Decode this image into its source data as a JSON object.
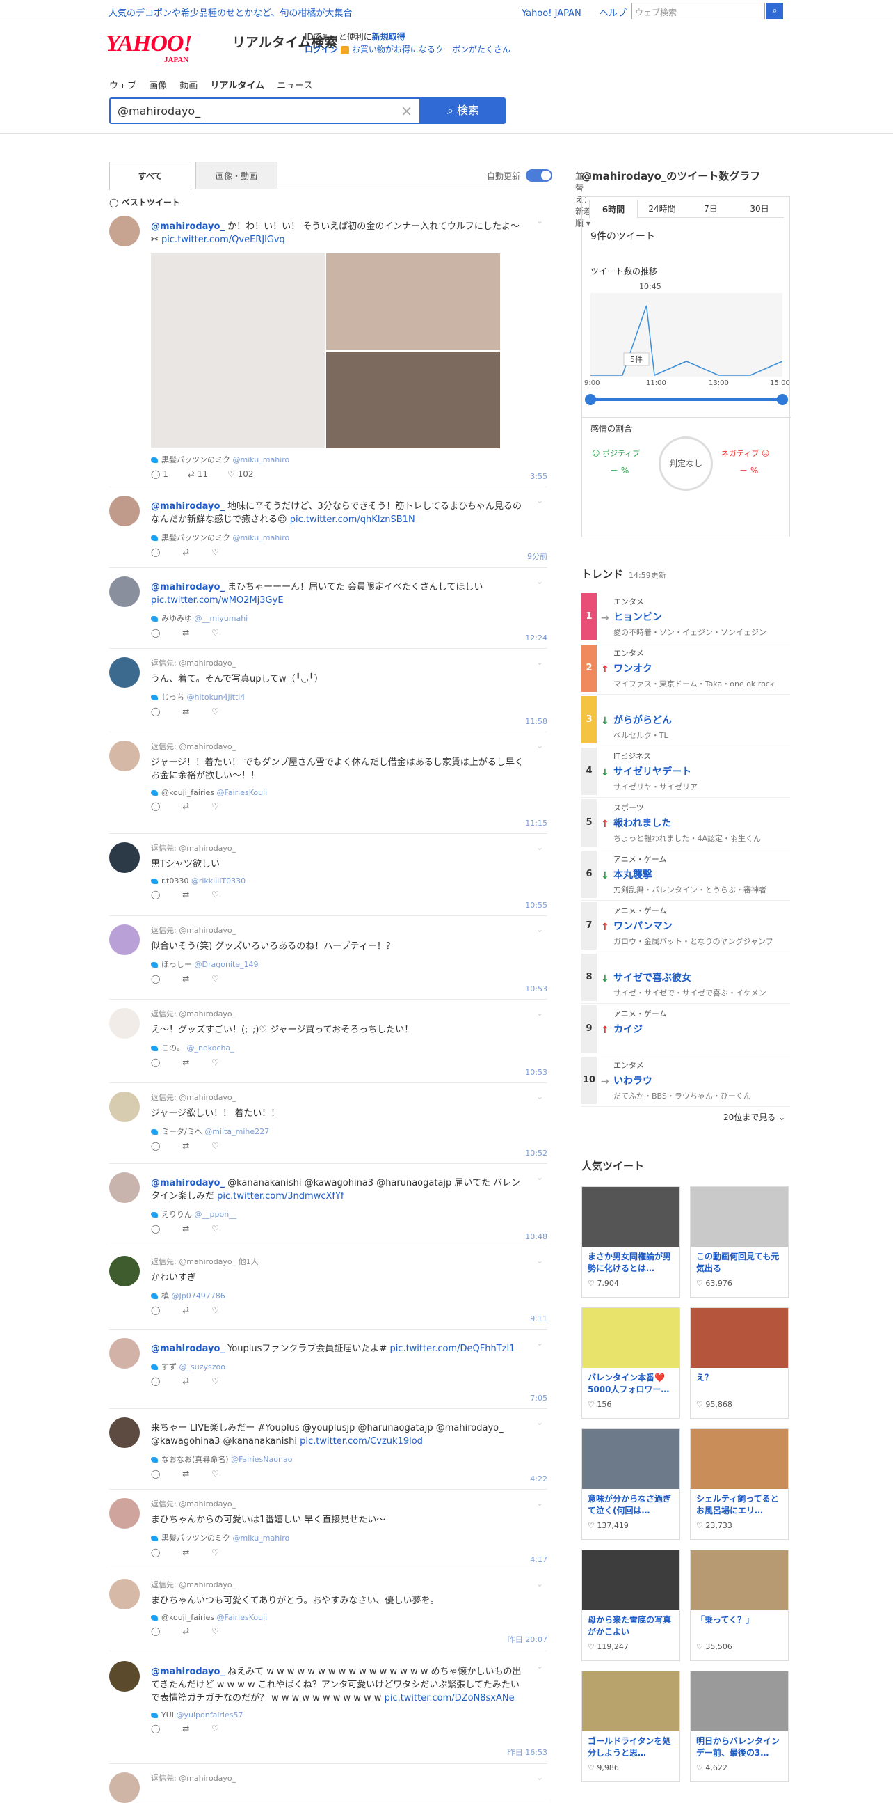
{
  "topbar": {
    "promo": "人気のデコポンや希少品種のせとかなど、旬の柑橘が大集合",
    "links": [
      "Yahoo! JAPAN",
      "ヘルプ"
    ],
    "mini_search_placeholder": "ウェブ検索"
  },
  "header": {
    "logo_text": "YAHOO!",
    "logo_sub": "JAPAN",
    "service_title": "リアルタイム検索",
    "msg_line1_a": "IDでもっと便利に",
    "msg_line1_b": "新規取得",
    "msg_login": "ログイン",
    "msg_coupon": "お買い物がお得になるクーポンがたくさん",
    "nav": [
      "ウェブ",
      "画像",
      "動画",
      "リアルタイム",
      "ニュース"
    ],
    "query": "@mahirodayo_",
    "search_button": "検索"
  },
  "tabs": {
    "all": "すべて",
    "media": "画像・動画",
    "auto_update": "自動更新",
    "sort": "並べ替え：新着順"
  },
  "best_tweet_label": "ベストツイート",
  "tweets": [
    {
      "reply": "",
      "text_a": "か！わ！い！い！ そういえば初の金のインナー入れてウルフにしたよ〜✂︎",
      "mention": "@mahirodayo_",
      "link": "pic.twitter.com/QveERJlGvq",
      "user": "黒髪パッツンのミク",
      "handle": "@miku_mahiro",
      "replies": "1",
      "rts": "11",
      "likes": "102",
      "time": "3:55"
    },
    {
      "reply": "",
      "text_a": "地味に辛そうだけど、3分ならできそう！筋トレしてるまひちゃん見るのなんだか新鮮な感じで癒される☺︎",
      "mention": "@mahirodayo_",
      "link": "pic.twitter.com/qhKlznSB1N",
      "user": "黒髪パッツンのミク",
      "handle": "@miku_mahiro",
      "replies": "",
      "rts": "",
      "likes": "",
      "time": "9分前"
    },
    {
      "reply": "",
      "text_a": "まひちゃーーーん！届いてた 会員限定イベたくさんしてほしい",
      "mention": "@mahirodayo_",
      "link": "pic.twitter.com/wMO2Mj3GyE",
      "user": "みゆみゆ",
      "handle": "@__miyumahi",
      "replies": "",
      "rts": "",
      "likes": "",
      "time": "12:24"
    },
    {
      "reply": "返信先: @mahirodayo_",
      "text_a": "うん、着て。そんで写真upしてw（╹◡╹）",
      "mention": "",
      "link": "",
      "user": "じっち",
      "handle": "@hitokun4jitti4",
      "replies": "",
      "rts": "",
      "likes": "",
      "time": "11:58"
    },
    {
      "reply": "返信先: @mahirodayo_",
      "text_a": "ジャージ！！着たい！ でもダンプ屋さん雪でよく休んだし借金はあるし家賃は上がるし早くお金に余裕が欲しい〜！！",
      "mention": "",
      "link": "",
      "user": "@kouji_fairies",
      "handle": "@FairiesKouji",
      "replies": "",
      "rts": "",
      "likes": "",
      "time": "11:15"
    },
    {
      "reply": "返信先: @mahirodayo_",
      "text_a": "黒Tシャツ欲しい",
      "mention": "",
      "link": "",
      "user": "r.t0330",
      "handle": "@rikkiiiiT0330",
      "replies": "",
      "rts": "",
      "likes": "",
      "time": "10:55"
    },
    {
      "reply": "返信先: @mahirodayo_",
      "text_a": "似合いそう(笑) グッズいろいろあるのね！ハーブティー！？",
      "mention": "",
      "link": "",
      "user": "ほっしー",
      "handle": "@Dragonite_149",
      "replies": "",
      "rts": "",
      "likes": "",
      "time": "10:53"
    },
    {
      "reply": "返信先: @mahirodayo_",
      "text_a": "え〜！グッズすごい！(;_;)♡ ジャージ買っておそろっちしたい！",
      "mention": "",
      "link": "",
      "user": "この。",
      "handle": "@_nokocha_",
      "replies": "",
      "rts": "",
      "likes": "",
      "time": "10:53"
    },
    {
      "reply": "返信先: @mahirodayo_",
      "text_a": "ジャージ欲しい！！ 着たい！！",
      "mention": "",
      "link": "",
      "user": "ミータ/ミヘ",
      "handle": "@miita_mihe227",
      "replies": "",
      "rts": "",
      "likes": "",
      "time": "10:52"
    },
    {
      "reply": "",
      "text_a": "@kananakanishi @kawagohina3 @harunaogatajp 届いてた バレンタイン楽しみだ",
      "mention": "@mahirodayo_",
      "link": "pic.twitter.com/3ndmwcXfYf",
      "user": "えりりん",
      "handle": "@__ppon__",
      "replies": "",
      "rts": "",
      "likes": "",
      "time": "10:48"
    },
    {
      "reply": "返信先: @mahirodayo_ 他1人",
      "text_a": "かわいすぎ",
      "mention": "",
      "link": "",
      "user": "槙",
      "handle": "@Jp07497786",
      "replies": "",
      "rts": "",
      "likes": "",
      "time": "9:11"
    },
    {
      "reply": "",
      "text_a": "Youplusファンクラブ会員証届いたよ#",
      "mention": "@mahirodayo_",
      "link": "pic.twitter.com/DeQFhhTzl1",
      "user": "すず",
      "handle": "@_suzyszoo",
      "replies": "",
      "rts": "",
      "likes": "",
      "time": "7:05"
    },
    {
      "reply": "",
      "text_a": "来ちゃー LIVE楽しみだー #Youplus @youplusjp @harunaogatajp @mahirodayo_ @kawagohina3 @kananakanishi",
      "mention": "",
      "link": "pic.twitter.com/Cvzuk19lod",
      "user": "なおなお(真尋命名)",
      "handle": "@FairiesNaonao",
      "replies": "",
      "rts": "",
      "likes": "",
      "time": "4:22"
    },
    {
      "reply": "返信先: @mahirodayo_",
      "text_a": "まひちゃんからの可愛いは1番嬉しい 早く直接見せたい〜",
      "mention": "",
      "link": "",
      "user": "黒髪パッツンのミク",
      "handle": "@miku_mahiro",
      "replies": "",
      "rts": "",
      "likes": "",
      "time": "4:17"
    },
    {
      "reply": "返信先: @mahirodayo_",
      "text_a": "まひちゃんいつも可愛くてありがとう。おやすみなさい、優しい夢を。",
      "mention": "",
      "link": "",
      "user": "@kouji_fairies",
      "handle": "@FairiesKouji",
      "replies": "",
      "rts": "",
      "likes": "",
      "time": "昨日 20:07"
    },
    {
      "reply": "",
      "text_a": "ねえみて w w w w w w w w w w w w w w w w めちゃ懐かしいもの出てきたんだけど w w w w これやばくね？アンタ可愛いけどワタシだいぶ緊張してたみたいで表情筋ガチガチなのだが？ w w w w w w w w w w w",
      "mention": "@mahirodayo_",
      "link": "pic.twitter.com/DZoN8sxANe",
      "user": "YUI",
      "handle": "@yuiponfairies57",
      "replies": "",
      "rts": "",
      "likes": "",
      "time": "昨日 16:53"
    },
    {
      "reply": "返信先: @mahirodayo_",
      "text_a": "",
      "mention": "",
      "link": "",
      "user": "",
      "handle": "",
      "replies": "",
      "rts": "",
      "likes": "",
      "time": ""
    }
  ],
  "graph": {
    "title": "@mahirodayo_のツイート数グラフ",
    "tabs": [
      "6時間",
      "24時間",
      "7日",
      "30日"
    ],
    "count_label": "9件のツイート",
    "trend_label": "ツイート数の推移",
    "peak_time": "10:45",
    "peak_count": "5件",
    "x_ticks": [
      "9:00",
      "11:00",
      "13:00",
      "15:00"
    ],
    "sentiment_title": "感情の割合",
    "positive": "ポジティブ",
    "negative": "ネガティブ",
    "pos_val": "－ %",
    "neg_val": "－ %",
    "judge": "判定なし"
  },
  "chart_data": {
    "type": "line",
    "x": [
      "9:00",
      "10:00",
      "10:45",
      "11:00",
      "12:00",
      "13:00",
      "14:00",
      "15:00"
    ],
    "series": [
      {
        "values": [
          0,
          0,
          5,
          0,
          1,
          0,
          0,
          1
        ]
      }
    ]
  },
  "trends": {
    "title": "トレンド",
    "updated": "14:59更新",
    "items": [
      {
        "rank": "1",
        "cat": "エンタメ",
        "word": "ヒョンビン",
        "rel": "愛の不時着・ソン・イェジン・ソンイェジン",
        "dir": "→",
        "color": "#e94e77"
      },
      {
        "rank": "2",
        "cat": "エンタメ",
        "word": "ワンオク",
        "rel": "マイファス・東京ドーム・Taka・one ok rock",
        "dir": "↑",
        "color": "#f08a5d"
      },
      {
        "rank": "3",
        "cat": "",
        "word": "がらがらどん",
        "rel": "ベルセルク・TL",
        "dir": "↓",
        "color": "#f5c342"
      },
      {
        "rank": "4",
        "cat": "ITビジネス",
        "word": "サイゼリヤデート",
        "rel": "サイゼリヤ・サイゼリア",
        "dir": "↓",
        "color": "#eeeeee"
      },
      {
        "rank": "5",
        "cat": "スポーツ",
        "word": "報われました",
        "rel": "ちょっと報われました・4A認定・羽生くん",
        "dir": "↑",
        "color": "#eeeeee"
      },
      {
        "rank": "6",
        "cat": "アニメ・ゲーム",
        "word": "本丸襲撃",
        "rel": "刀剣乱舞・バレンタイン・とうらぶ・審神者",
        "dir": "↓",
        "color": "#eeeeee"
      },
      {
        "rank": "7",
        "cat": "アニメ・ゲーム",
        "word": "ワンパンマン",
        "rel": "ガロウ・金属バット・となりのヤングジャンプ",
        "dir": "↑",
        "color": "#eeeeee"
      },
      {
        "rank": "8",
        "cat": "",
        "word": "サイゼで喜ぶ彼女",
        "rel": "サイゼ・サイゼで・サイゼで喜ぶ・イケメン",
        "dir": "↓",
        "color": "#eeeeee"
      },
      {
        "rank": "9",
        "cat": "アニメ・ゲーム",
        "word": "カイジ",
        "rel": "",
        "dir": "↑",
        "color": "#eeeeee"
      },
      {
        "rank": "10",
        "cat": "エンタメ",
        "word": "いわラウ",
        "rel": "だてふか・BBS・ラウちゃん・ひーくん",
        "dir": "→",
        "color": "#eeeeee"
      }
    ],
    "more": "20位まで見る"
  },
  "popular": {
    "title": "人気ツイート",
    "items": [
      {
        "title": "まさか男女同権論が男勢に化けるとは…",
        "likes": "7,904",
        "c": "#555"
      },
      {
        "title": "この動画何回見ても元気出る",
        "likes": "63,976",
        "c": "#c9c9c9"
      },
      {
        "title": "バレンタイン本番❤️5000人フォロワー…",
        "likes": "156",
        "c": "#e8e36b"
      },
      {
        "title": "え？",
        "likes": "95,868",
        "c": "#b5553b"
      },
      {
        "title": "意味が分からなさ過ぎて泣く(何回は…",
        "likes": "137,419",
        "c": "#6d7a8a"
      },
      {
        "title": "シェルティ飼ってるとお風呂場にエリ…",
        "likes": "23,733",
        "c": "#c98d5a"
      },
      {
        "title": "母から来た雪底の写真がかこよい",
        "likes": "119,247",
        "c": "#3d3d3d"
      },
      {
        "title": "「乗ってく？」",
        "likes": "35,506",
        "c": "#b89a72"
      },
      {
        "title": "ゴールドライタンを処分しようと思…",
        "likes": "9,986",
        "c": "#b8a36d"
      },
      {
        "title": "明日からバレンタインデー前、最後の3…",
        "likes": "4,622",
        "c": "#9a9a9a"
      }
    ]
  }
}
